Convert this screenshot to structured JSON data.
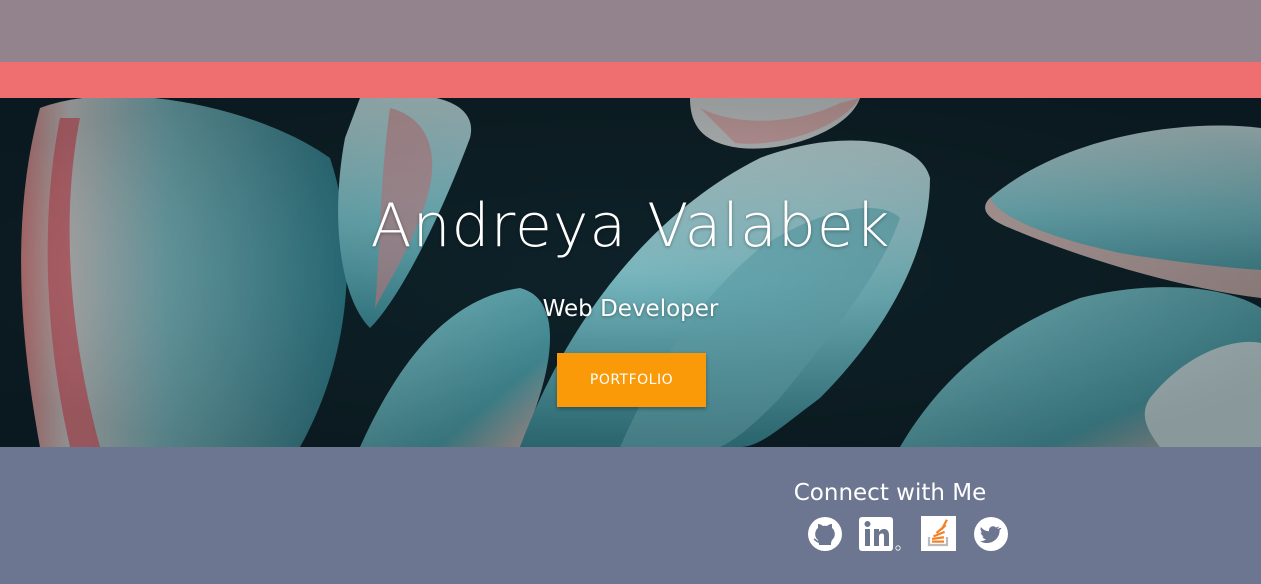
{
  "header": {
    "background_color": "#93838d",
    "accent_color": "#ef6f70"
  },
  "hero": {
    "title": "Andreya Valabek",
    "subtitle": "Web Developer",
    "button_label": "PORTFOLIO",
    "button_color": "#fb9a08",
    "background_image": "succulent-leaves-photo"
  },
  "footer": {
    "background_color": "#6d7691",
    "heading": "Connect with Me",
    "social_links": [
      {
        "name": "github",
        "icon": "github-icon"
      },
      {
        "name": "linkedin",
        "icon": "linkedin-icon"
      },
      {
        "name": "stackoverflow",
        "icon": "stackoverflow-icon"
      },
      {
        "name": "twitter",
        "icon": "twitter-icon"
      }
    ]
  }
}
